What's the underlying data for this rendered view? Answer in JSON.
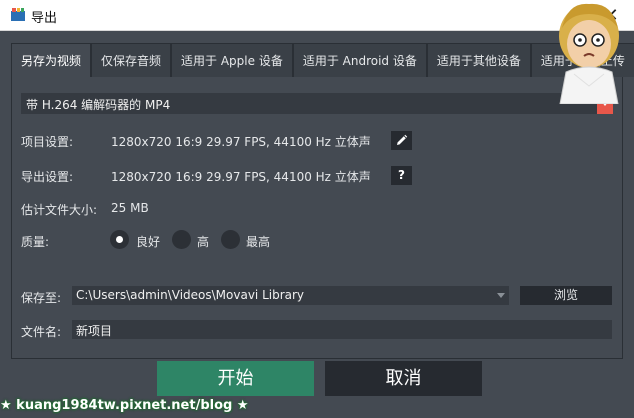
{
  "window": {
    "title": "导出",
    "close_glyph": "✕"
  },
  "watermark": {
    "caption": "kuang1984tw.pixnet.net/blog",
    "footer": "★ kuang1984tw.pixnet.net/blog ★"
  },
  "tabs": [
    {
      "label": "另存为视频",
      "active": true
    },
    {
      "label": "仅保存音频",
      "active": false
    },
    {
      "label": "适用于 Apple 设备",
      "active": false
    },
    {
      "label": "适用于 Android 设备",
      "active": false
    },
    {
      "label": "适用于其他设备",
      "active": false
    },
    {
      "label": "适用于在线上传",
      "active": false
    }
  ],
  "format": {
    "selected": "带 H.264 编解码器的 MP4"
  },
  "project_settings": {
    "label": "项目设置:",
    "value": "1280x720 16:9 29.97 FPS, 44100 Hz 立体声",
    "edit_icon": "pencil-icon"
  },
  "export_settings": {
    "label": "导出设置:",
    "value": "1280x720 16:9 29.97 FPS, 44100 Hz 立体声",
    "help_glyph": "?"
  },
  "file_size": {
    "label": "估计文件大小:",
    "value": "25 MB"
  },
  "quality": {
    "label": "质量:",
    "options": [
      {
        "label": "良好",
        "checked": true
      },
      {
        "label": "高",
        "checked": false
      },
      {
        "label": "最高",
        "checked": false
      }
    ]
  },
  "save_to": {
    "label": "保存至:",
    "value": "C:\\Users\\admin\\Videos\\Movavi Library",
    "browse_label": "浏览"
  },
  "file_name": {
    "label": "文件名:",
    "value": "新项目"
  },
  "actions": {
    "start_label": "开始",
    "cancel_label": "取消"
  },
  "colors": {
    "panel": "#444a52",
    "start": "#2e8566",
    "accent": "#e8574a"
  }
}
